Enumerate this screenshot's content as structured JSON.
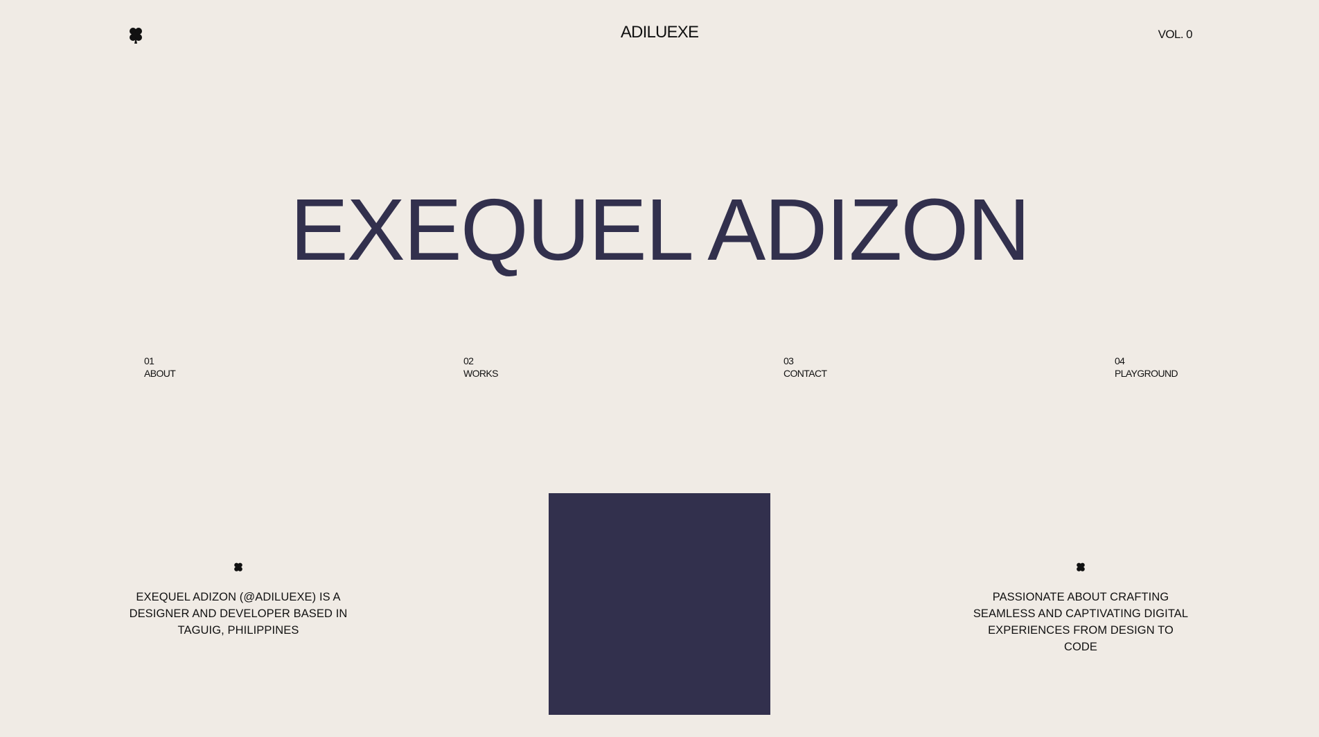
{
  "header": {
    "logo_icon": "clover-icon",
    "brand": "ADILUEXE",
    "volume": "VOL. 0"
  },
  "hero": {
    "title": "EXEQUEL ADIZON",
    "color": "#32304d"
  },
  "nav": {
    "items": [
      {
        "number": "01",
        "label": "ABOUT"
      },
      {
        "number": "02",
        "label": "WORKS"
      },
      {
        "number": "03",
        "label": "CONTACT"
      },
      {
        "number": "04",
        "label": "PLAYGROUND"
      }
    ]
  },
  "info": {
    "left": {
      "icon": "clover-icon",
      "text": "EXEQUEL ADIZON (@ADILUEXE) IS A DESIGNER AND DEVELOPER BASED IN TAGUIG, PHILIPPINES"
    },
    "right": {
      "icon": "clover-icon",
      "text": "PASSIONATE ABOUT CRAFTING SEAMLESS AND CAPTIVATING DIGITAL EXPERIENCES FROM DESIGN TO CODE"
    }
  },
  "colors": {
    "background": "#f0ebe5",
    "accent": "#32304d",
    "text": "#111111"
  }
}
